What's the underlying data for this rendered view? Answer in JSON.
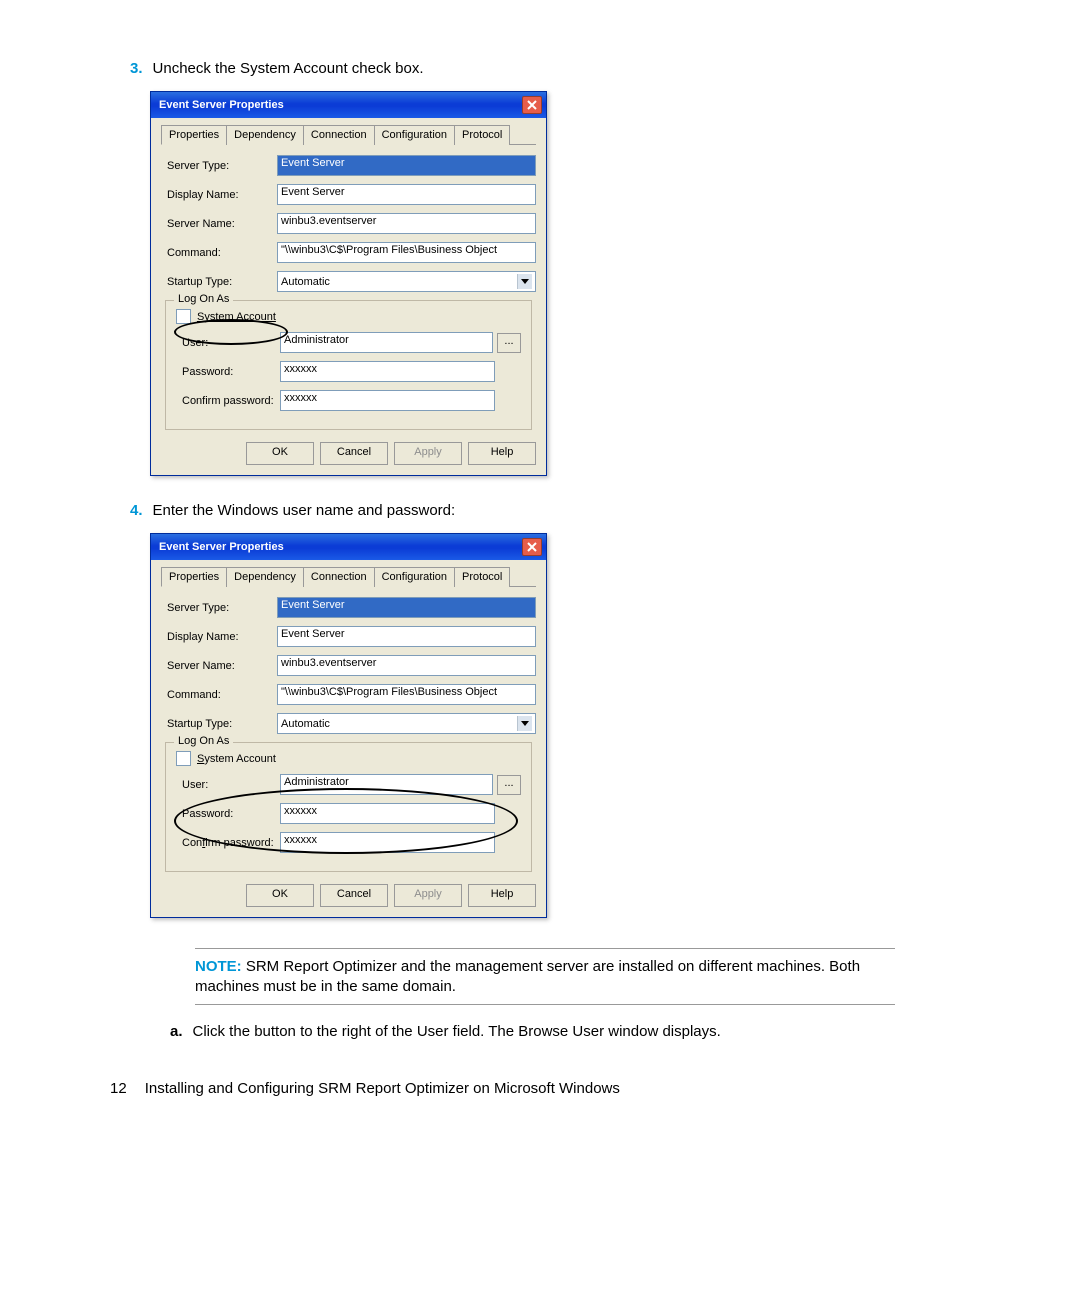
{
  "steps": {
    "s3_num": "3.",
    "s3_text": "Uncheck the System Account check box.",
    "s4_num": "4.",
    "s4_text": "Enter the Windows user name and password:",
    "sa_num": "a.",
    "sa_text": "Click the button to the right of the User field. The Browse User window displays."
  },
  "dialog": {
    "title": "Event Server Properties",
    "tabs": [
      "Properties",
      "Dependency",
      "Connection",
      "Configuration",
      "Protocol"
    ],
    "labels": {
      "server_type": "Server Type:",
      "display_name": "Display Name:",
      "server_name": "Server Name:",
      "command": "Command:",
      "startup_type": "Startup Type:",
      "logon_legend": "Log On As",
      "system_account": "System Account",
      "user": "User:",
      "password": "Password:",
      "confirm": "Confirm password:"
    },
    "values": {
      "server_type": "Event Server",
      "display_name": "Event Server",
      "server_name": "winbu3.eventserver",
      "command": "\"\\\\winbu3\\C$\\Program Files\\Business Object",
      "startup_type": "Automatic",
      "user": "Administrator",
      "password": "xxxxxx",
      "confirm": "xxxxxx",
      "browse": "..."
    },
    "buttons": {
      "ok": "OK",
      "cancel": "Cancel",
      "apply": "Apply",
      "help": "Help"
    }
  },
  "note": {
    "label": "NOTE:",
    "text": "SRM Report Optimizer and the management server are installed on different machines. Both machines must be in the same domain."
  },
  "footer": {
    "page": "12",
    "title": "Installing and Configuring SRM Report Optimizer on Microsoft Windows"
  }
}
